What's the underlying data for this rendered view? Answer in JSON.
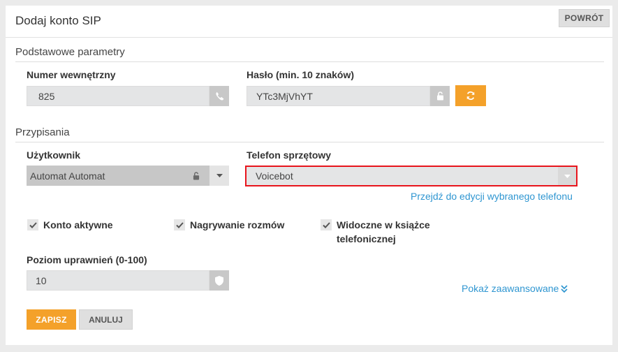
{
  "header": {
    "title": "Dodaj konto SIP",
    "back_label": "POWRÓT"
  },
  "sections": {
    "basic": "Podstawowe parametry",
    "assign": "Przypisania"
  },
  "fields": {
    "extension": {
      "label": "Numer wewnętrzny",
      "value": "825"
    },
    "password": {
      "label": "Hasło (min. 10 znaków)",
      "value": "YTc3MjVhYT"
    },
    "user": {
      "label": "Użytkownik",
      "value": "Automat Automat"
    },
    "hardware_phone": {
      "label": "Telefon sprzętowy",
      "value": "Voicebot",
      "edit_link": "Przejdź do edycji wybranego telefonu"
    },
    "permission_level": {
      "label": "Poziom uprawnień (0-100)",
      "value": "10"
    }
  },
  "checkboxes": [
    {
      "label": "Konto aktywne",
      "checked": true
    },
    {
      "label": "Nagrywanie rozmów",
      "checked": true
    },
    {
      "label": "Widoczne w książce telefonicznej",
      "checked": true
    }
  ],
  "advanced_link": "Pokaż zaawansowane",
  "actions": {
    "save": "ZAPISZ",
    "cancel": "ANULUJ"
  },
  "colors": {
    "accent": "#f4a12a",
    "link": "#2f96d1",
    "highlight": "#e8141c"
  },
  "icons": [
    "phone-icon",
    "lock-icon",
    "refresh-icon",
    "chevron-down-icon",
    "check-icon",
    "shield-icon",
    "double-chevron-down-icon"
  ]
}
